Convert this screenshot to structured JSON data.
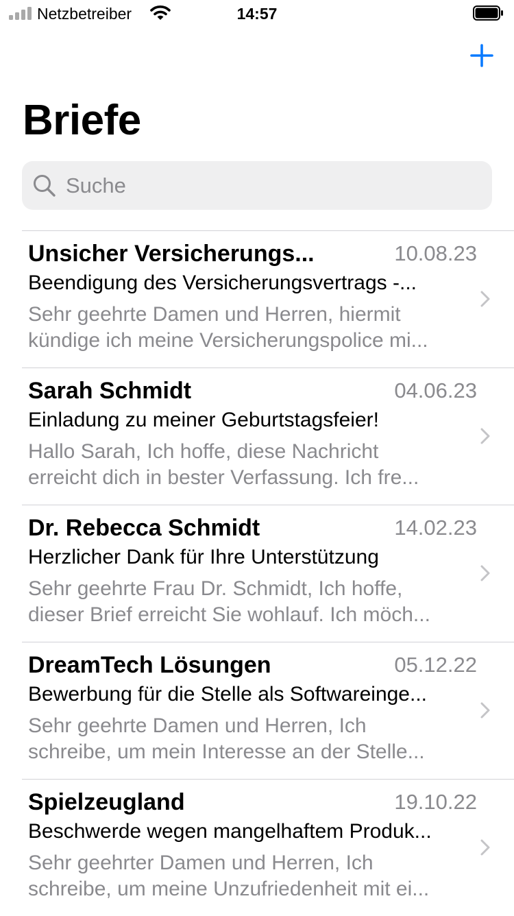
{
  "status_bar": {
    "carrier": "Netzbetreiber",
    "time": "14:57",
    "signal_icon": "signal-bars-icon",
    "wifi_icon": "wifi-icon",
    "battery_icon": "battery-icon"
  },
  "nav": {
    "add_icon": "plus-icon",
    "title": "Briefe"
  },
  "search": {
    "icon": "magnifier-icon",
    "placeholder": "Suche",
    "value": ""
  },
  "letters": [
    {
      "sender": "Unsicher Versicherungs...",
      "date": "10.08.23",
      "subject": "Beendigung des Versicherungsvertrags -...",
      "preview_line1": "Sehr geehrte Damen und Herren,  hiermit",
      "preview_line2": "kündige ich meine Versicherungspolice mi..."
    },
    {
      "sender": "Sarah Schmidt",
      "date": "04.06.23",
      "subject": "Einladung zu meiner Geburtstagsfeier!",
      "preview_line1": "Hallo Sarah,  Ich hoffe, diese Nachricht",
      "preview_line2": "erreicht dich in bester Verfassung. Ich fre..."
    },
    {
      "sender": "Dr. Rebecca Schmidt",
      "date": "14.02.23",
      "subject": "Herzlicher Dank für Ihre Unterstützung",
      "preview_line1": "Sehr geehrte Frau Dr. Schmidt,  Ich hoffe,",
      "preview_line2": "dieser Brief erreicht Sie wohlauf. Ich möch..."
    },
    {
      "sender": "DreamTech Lösungen",
      "date": "05.12.22",
      "subject": "Bewerbung für die Stelle als Softwareinge...",
      "preview_line1": "Sehr geehrte Damen und Herren,  Ich",
      "preview_line2": "schreibe, um mein Interesse an der Stelle..."
    },
    {
      "sender": "Spielzeugland",
      "date": "19.10.22",
      "subject": "Beschwerde wegen mangelhaftem Produk...",
      "preview_line1": "Sehr geehrter Damen und Herren,  Ich",
      "preview_line2": "schreibe, um meine Unzufriedenheit mit ei..."
    }
  ],
  "colors": {
    "accent": "#0a7aff",
    "secondary_text": "#8a8a8e",
    "search_background": "#efeff0",
    "separator": "#d1d1d6"
  },
  "row_chevron_icon": "chevron-right-icon"
}
